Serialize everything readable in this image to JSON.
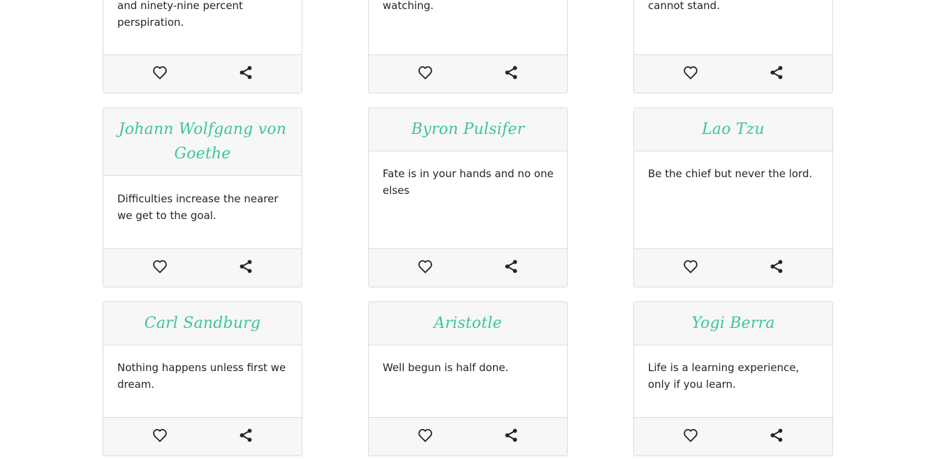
{
  "cards": [
    {
      "author": "",
      "quote": "and ninety-nine percent perspiration."
    },
    {
      "author": "",
      "quote": "watching."
    },
    {
      "author": "",
      "quote": "cannot stand."
    },
    {
      "author": "Johann Wolfgang von Goethe",
      "quote": "Difficulties increase the nearer we get to the goal."
    },
    {
      "author": "Byron Pulsifer",
      "quote": "Fate is in your hands and no one elses"
    },
    {
      "author": "Lao Tzu",
      "quote": "Be the chief but never the lord."
    },
    {
      "author": "Carl Sandburg",
      "quote": "Nothing happens unless first we dream."
    },
    {
      "author": "Aristotle",
      "quote": "Well begun is half done."
    },
    {
      "author": "Yogi Berra",
      "quote": "Life is a learning experience, only if you learn."
    }
  ],
  "icons": {
    "like": "heart-icon",
    "share": "share-icon"
  },
  "colors": {
    "author": "#3dc693",
    "card_header_bg": "#f7f7f7",
    "border": "#dcdcdc"
  }
}
